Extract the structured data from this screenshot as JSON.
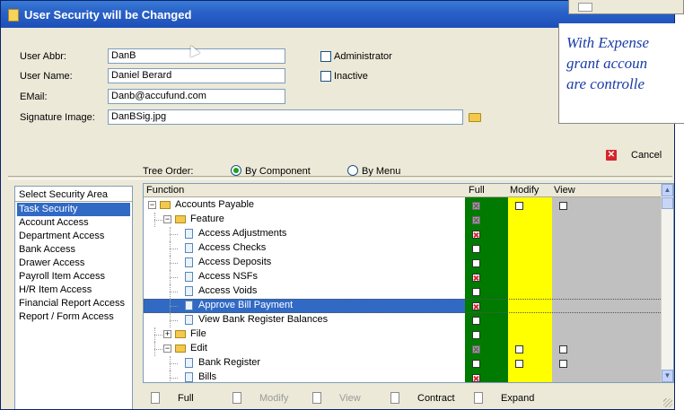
{
  "window": {
    "title": "User Security will be Changed"
  },
  "form": {
    "user_abbr_label": "User Abbr:",
    "user_abbr_value": "DanB",
    "user_name_label": "User Name:",
    "user_name_value": "Daniel Berard",
    "email_label": "EMail:",
    "email_value": "Danb@accufund.com",
    "signature_label": "Signature Image:",
    "signature_value": "DanBSig.jpg",
    "administrator_label": "Administrator",
    "inactive_label": "Inactive"
  },
  "note": {
    "lines": [
      "With Expense",
      "grant accoun",
      "are controlle"
    ]
  },
  "buttons": {
    "cancel_label": "Cancel"
  },
  "security_areas": {
    "header": "Select Security Area",
    "items": [
      "Task Security",
      "Account Access",
      "Department Access",
      "Bank Access",
      "Drawer Access",
      "Payroll Item Access",
      "H/R Item Access",
      "Financial Report Access",
      "Report / Form Access"
    ],
    "selected_index": 0
  },
  "tree_order": {
    "label": "Tree Order:",
    "options": [
      "By Component",
      "By Menu"
    ],
    "selected": "By Component"
  },
  "tree": {
    "columns": {
      "function": "Function",
      "full": "Full",
      "modify": "Modify",
      "view": "View"
    },
    "colors": {
      "full": "#007a00",
      "modify": "#ffff00",
      "view": "#c0c0c0"
    },
    "rows": [
      {
        "label": "Accounts Payable",
        "level": 0,
        "kind": "folder",
        "expander": "minus",
        "full": "grey",
        "modify": "empty",
        "view": "empty"
      },
      {
        "label": "Feature",
        "level": 1,
        "kind": "folder",
        "expander": "minus",
        "full": "grey",
        "modify": "",
        "view": ""
      },
      {
        "label": "Access Adjustments",
        "level": 2,
        "kind": "doc",
        "full": "x",
        "modify": "",
        "view": ""
      },
      {
        "label": "Access Checks",
        "level": 2,
        "kind": "doc",
        "full": "empty",
        "modify": "",
        "view": ""
      },
      {
        "label": "Access Deposits",
        "level": 2,
        "kind": "doc",
        "full": "empty",
        "modify": "",
        "view": ""
      },
      {
        "label": "Access NSFs",
        "level": 2,
        "kind": "doc",
        "full": "x",
        "modify": "",
        "view": ""
      },
      {
        "label": "Access Voids",
        "level": 2,
        "kind": "doc",
        "full": "empty",
        "modify": "",
        "view": ""
      },
      {
        "label": "Approve Bill Payment",
        "level": 2,
        "kind": "doc",
        "full": "x",
        "modify": "",
        "view": "",
        "selected": true
      },
      {
        "label": "View Bank Register Balances",
        "level": 2,
        "kind": "doc",
        "full": "empty",
        "modify": "",
        "view": ""
      },
      {
        "label": "File",
        "level": 1,
        "kind": "folder",
        "expander": "plus",
        "full": "empty",
        "modify": "",
        "view": ""
      },
      {
        "label": "Edit",
        "level": 1,
        "kind": "folder",
        "expander": "minus",
        "full": "grey",
        "modify": "empty",
        "view": "empty"
      },
      {
        "label": "Bank Register",
        "level": 2,
        "kind": "doc",
        "full": "empty",
        "modify": "empty",
        "view": "empty"
      },
      {
        "label": "Bills",
        "level": 2,
        "kind": "doc",
        "full": "x",
        "modify": "",
        "view": ""
      }
    ]
  },
  "bottom_buttons": [
    {
      "label": "Full",
      "enabled": true
    },
    {
      "label": "Modify",
      "enabled": false
    },
    {
      "label": "View",
      "enabled": false
    },
    {
      "label": "Contract",
      "enabled": true
    },
    {
      "label": "Expand",
      "enabled": true
    }
  ]
}
